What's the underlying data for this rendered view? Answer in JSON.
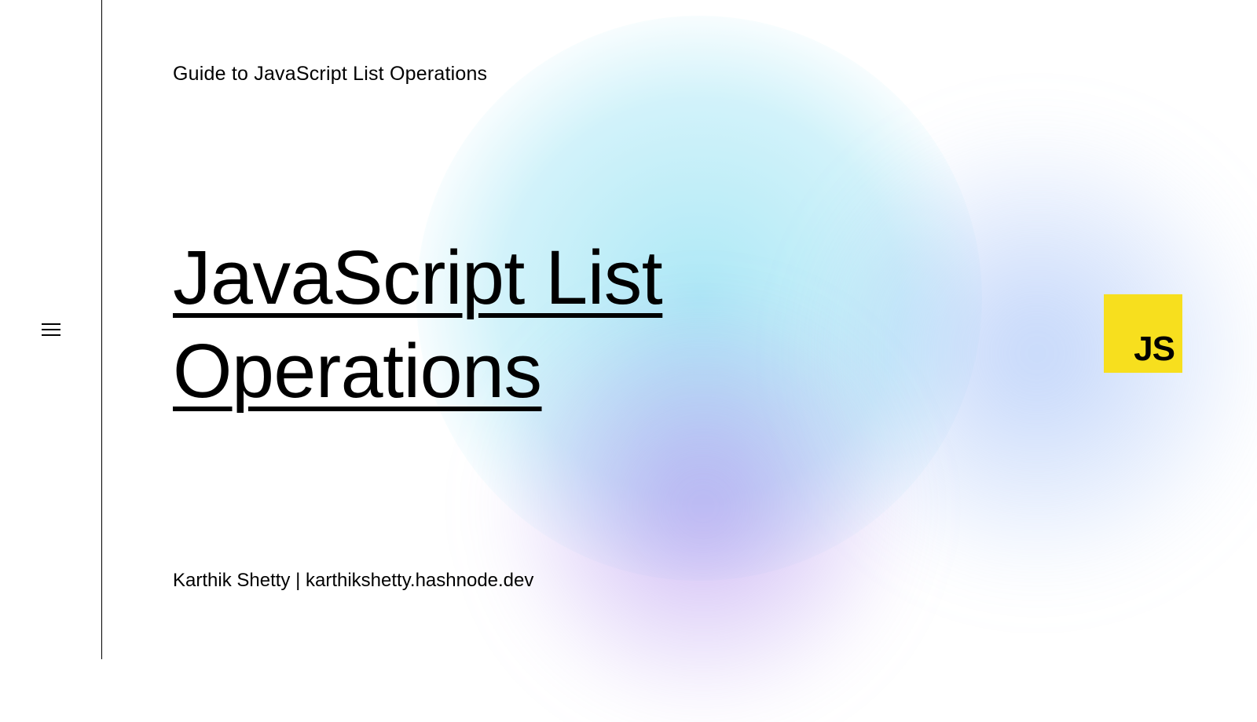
{
  "header": {
    "subtitle": "Guide to JavaScript List Operations"
  },
  "main": {
    "title": "JavaScript List Operations"
  },
  "footer": {
    "author": "Karthik Shetty | karthikshetty.hashnode.dev"
  },
  "logo": {
    "text": "JS"
  }
}
